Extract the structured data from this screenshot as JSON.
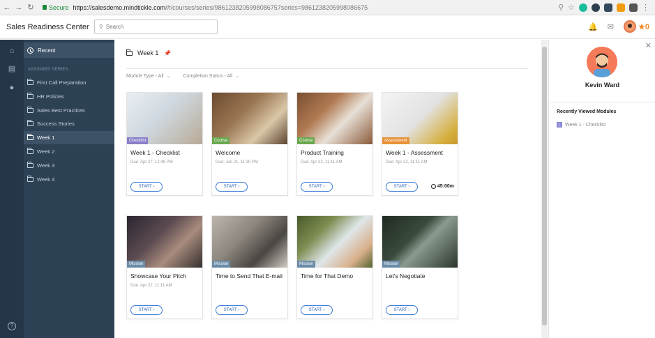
{
  "browser": {
    "secure_label": "Secure",
    "url_host": "https://salesdemo.mindtickle.com",
    "url_path": "/#/courses/series/9861238205998086757series=9861238205998086675"
  },
  "header": {
    "title": "Sales Readiness Center",
    "search_placeholder": "Search",
    "points": "0"
  },
  "sidebar": {
    "recent_label": "Recent",
    "section_label": "ASSIGNED SERIES",
    "items": [
      {
        "label": "First Call Preparation"
      },
      {
        "label": "HR Policies"
      },
      {
        "label": "Sales Best Practices"
      },
      {
        "label": "Success Stories"
      },
      {
        "label": "Week 1"
      },
      {
        "label": "Week 2"
      },
      {
        "label": "Week 3"
      },
      {
        "label": "Week 4"
      }
    ]
  },
  "main": {
    "title": "Week 1",
    "filters": {
      "module_type": "Module Type - All",
      "completion_status": "Completion Status - All"
    },
    "cards": [
      {
        "title": "Week 1 - Checklist",
        "badge": "Checklist",
        "badge_color": "#8a7fc8",
        "due": "Due: Apr 27, 12:48 PM",
        "start": "START",
        "duration": ""
      },
      {
        "title": "Welcome",
        "badge": "Course",
        "badge_color": "#6aa84f",
        "due": "Due: Jun 21, 11:30 PM",
        "start": "START",
        "duration": ""
      },
      {
        "title": "Product Training",
        "badge": "Course",
        "badge_color": "#6aa84f",
        "due": "Due: Apr 22, 11:11 AM",
        "start": "START",
        "duration": ""
      },
      {
        "title": "Week 1 - Assessment",
        "badge": "Assessment",
        "badge_color": "#e8923a",
        "due": "Due: Apr 22, 11:11 AM",
        "start": "START",
        "duration": "45:00m"
      },
      {
        "title": "Showcase Your Pitch",
        "badge": "Mission",
        "badge_color": "#6b8ca8",
        "due": "Due: Apr 22, 11:11 AM",
        "start": "START",
        "duration": ""
      },
      {
        "title": "Time to Send That E-mail",
        "badge": "Mission",
        "badge_color": "#6b8ca8",
        "due": "",
        "start": "START",
        "duration": ""
      },
      {
        "title": "Time for That Demo",
        "badge": "Mission",
        "badge_color": "#6b8ca8",
        "due": "",
        "start": "START",
        "duration": ""
      },
      {
        "title": "Let's Negotiate",
        "badge": "Mission",
        "badge_color": "#6b8ca8",
        "due": "",
        "start": "START",
        "duration": ""
      }
    ]
  },
  "right_panel": {
    "user_name": "Kevin Ward",
    "recent_heading": "Recently Viewed Modules",
    "recent_items": [
      {
        "label": "Week 1 - Checklist",
        "icon_letter": "L"
      }
    ]
  }
}
